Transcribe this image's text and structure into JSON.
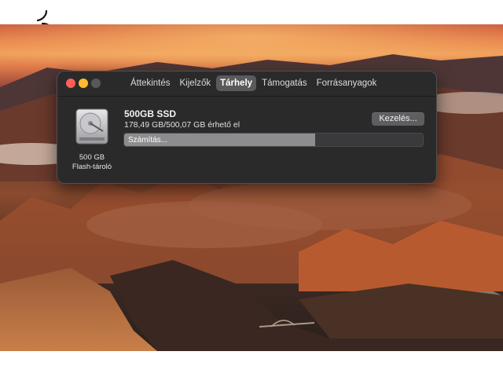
{
  "window": {
    "traffic_lights": {
      "close_color": "#fe5f57",
      "minimize_color": "#febc2e",
      "zoom_color": "#58575a"
    },
    "tabs": [
      {
        "label": "Áttekintés",
        "active": false
      },
      {
        "label": "Kijelzők",
        "active": false
      },
      {
        "label": "Tárhely",
        "active": true
      },
      {
        "label": "Támogatás",
        "active": false
      },
      {
        "label": "Forrásanyagok",
        "active": false
      }
    ]
  },
  "storage": {
    "icon": "hard-drive-icon",
    "capacity_label": "500 GB",
    "type_label": "Flash-tároló",
    "disk_name": "500GB SSD",
    "available_text": "178,49 GB/500,07 GB érhető el",
    "manage_label": "Kezelés...",
    "progress_label": "Számítás...",
    "progress_fraction": 0.64
  },
  "overlay": {
    "logo": "apple-outline-with-clover-logo"
  }
}
